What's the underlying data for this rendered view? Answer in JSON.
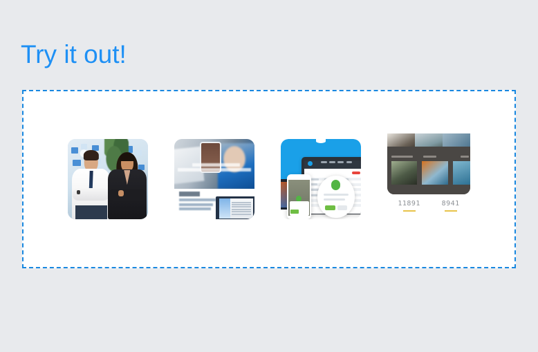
{
  "page": {
    "title": "Try it out!",
    "background_color": "#e8eaed",
    "title_color": "#1e90f5"
  },
  "dropzone": {
    "name": "image-drop-area",
    "border_style": "dashed",
    "border_color": "#1787e0",
    "background_color": "#ffffff"
  },
  "thumbnails": [
    {
      "name": "thumbnail-business-people",
      "alt": "Two business professionals standing with arms crossed in an office with blue sticky notes on the wall",
      "type": "photo"
    },
    {
      "name": "thumbnail-website-hero",
      "alt": "Blurred website screenshot with a hero banner, social icons and an article section below",
      "type": "screenshot"
    },
    {
      "name": "thumbnail-app-dashboard",
      "alt": "Blue promotional graphic showing a tablet dashboard, smartphone mockup and a circular magnified detail with a green check mark",
      "type": "mockup"
    },
    {
      "name": "thumbnail-dark-gallery",
      "alt": "Dark themed photo gallery grid with caption labels",
      "type": "screenshot",
      "counters": [
        {
          "value": "11891",
          "accent": "#e8c34a"
        },
        {
          "value": "8941",
          "accent": "#e8c34a"
        }
      ]
    }
  ]
}
